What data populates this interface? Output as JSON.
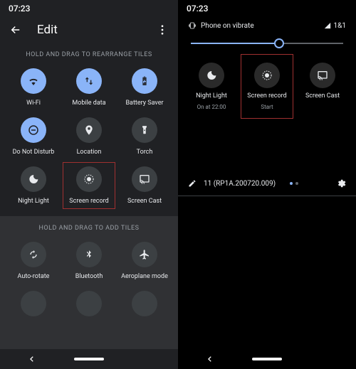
{
  "clock": "07:23",
  "left": {
    "title": "Edit",
    "hint_rearrange": "HOLD AND DRAG TO REARRANGE TILES",
    "hint_add": "HOLD AND DRAG TO ADD TILES",
    "tiles": {
      "wifi": "Wi-Fi",
      "mobile_data": "Mobile data",
      "battery_saver": "Battery Saver",
      "dnd": "Do Not Disturb",
      "location": "Location",
      "torch": "Torch",
      "night_light": "Night Light",
      "screen_record": "Screen record",
      "screen_cast": "Screen Cast",
      "auto_rotate": "Auto-rotate",
      "bluetooth": "Bluetooth",
      "aeroplane": "Aeroplane mode"
    }
  },
  "right": {
    "vibrate_label": "Phone on vibrate",
    "signal_label": "1&1",
    "brightness_percent": 58,
    "tiles": {
      "night_light": {
        "label": "Night Light",
        "sub": "On at 22:00"
      },
      "screen_record": {
        "label": "Screen record",
        "sub": "Start"
      },
      "screen_cast": {
        "label": "Screen Cast",
        "sub": ""
      }
    },
    "build": "11 (RP1A.200720.009)"
  }
}
